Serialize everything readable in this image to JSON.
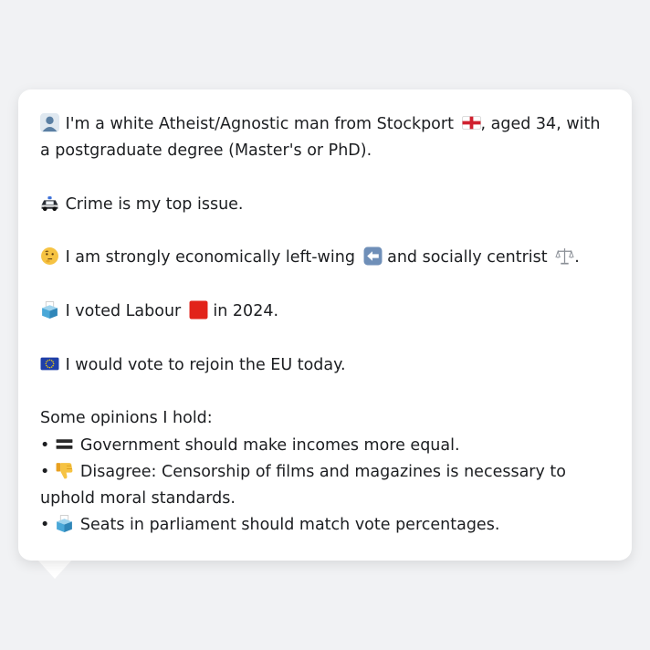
{
  "bio": {
    "profile_icon": "bust-in-silhouette-icon",
    "line1_a": "I'm a white Atheist/Agnostic man from Stockport",
    "flag_icon": "england-flag-icon",
    "line1_b": ", aged 34, with a postgraduate degree (Master's or PhD)."
  },
  "issue": {
    "icon": "police-car-icon",
    "text": "Crime is my top issue."
  },
  "ideology": {
    "icon": "thinking-face-icon",
    "text_a": "I am strongly economically left-wing",
    "left_icon": "left-arrow-icon",
    "text_b": "and socially centrist",
    "scales_icon": "balance-scale-icon",
    "text_c": "."
  },
  "vote": {
    "icon": "ballot-box-icon",
    "text_a": "I voted Labour",
    "party_icon": "red-square-icon",
    "text_b": "in 2024."
  },
  "eu": {
    "icon": "eu-flag-icon",
    "text": "I would vote to rejoin the EU today."
  },
  "opinions": {
    "heading": "Some opinions I hold:",
    "bullet": "•",
    "items": [
      {
        "icon": "equals-icon",
        "text": "Government should make incomes more equal."
      },
      {
        "icon": "thumbs-down-icon",
        "text": "Disagree: Censorship of films and magazines is necessary to uphold moral standards."
      },
      {
        "icon": "ballot-box-icon",
        "text": "Seats in parliament should match vote percentages."
      }
    ]
  },
  "colors": {
    "background": "#f1f2f4",
    "card": "#ffffff",
    "text": "#1c1e21"
  }
}
